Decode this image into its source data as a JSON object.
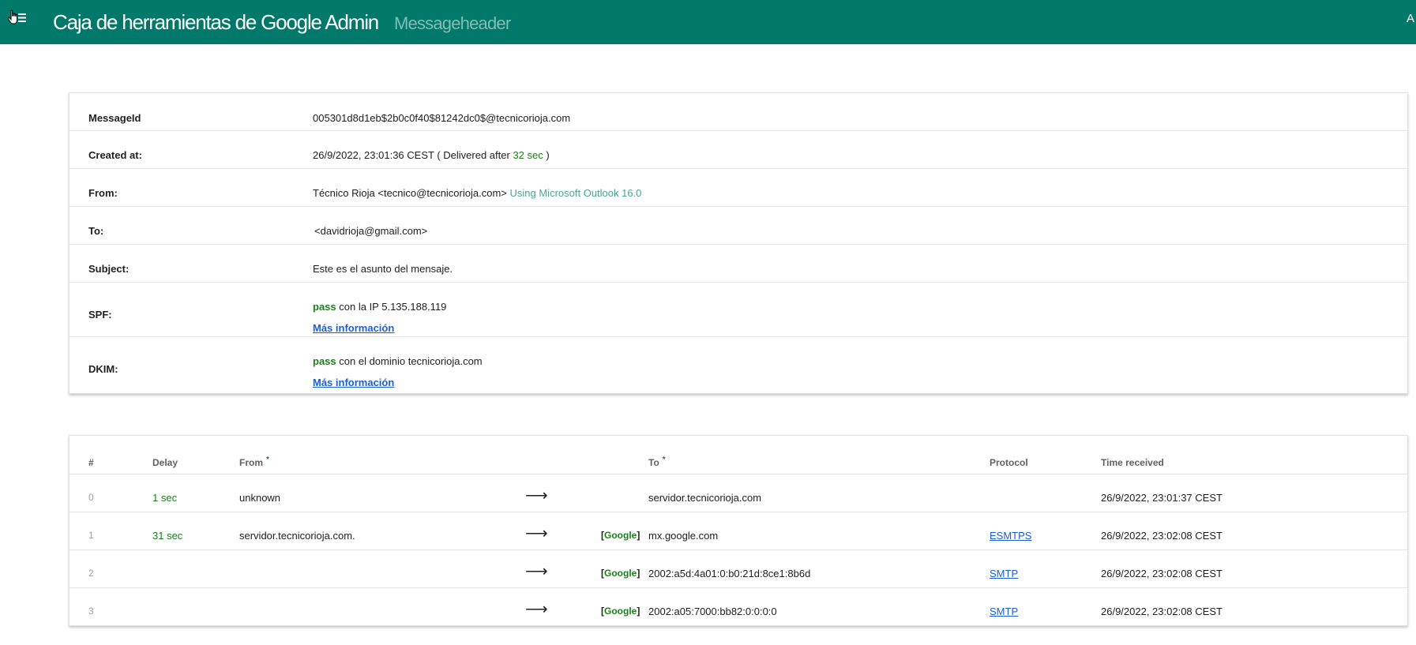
{
  "header": {
    "title": "Caja de herramientas de Google Admin",
    "subtitle": "Messageheader",
    "right_text": "A"
  },
  "details": {
    "message_id": {
      "label": "MessageId",
      "value": "005301d8d1eb$2b0c0f40$81242dc0$@tecnicorioja.com"
    },
    "created_at": {
      "label": "Created at:",
      "value": "26/9/2022, 23:01:36 CEST",
      "delivered_prefix": "( Delivered after",
      "delivered_time": "32 sec",
      "delivered_suffix": ")"
    },
    "from": {
      "label": "From:",
      "value": "Técnico Rioja <tecnico@tecnicorioja.com>",
      "client": "Using Microsoft Outlook 16.0"
    },
    "to": {
      "label": "To:",
      "value": "<davidrioja@gmail.com>"
    },
    "subject": {
      "label": "Subject:",
      "value": "Este es el asunto del mensaje."
    },
    "spf": {
      "label": "SPF:",
      "result": "pass",
      "detail": "con la IP 5.135.188.119",
      "link": "Más información"
    },
    "dkim": {
      "label": "DKIM:",
      "result": "pass",
      "detail": "con el dominio tecnicorioja.com",
      "link": "Más información"
    }
  },
  "hops": {
    "columns": {
      "num": "#",
      "delay": "Delay",
      "from": "From",
      "to": "To",
      "protocol": "Protocol",
      "time": "Time received",
      "star": "*"
    },
    "arrow": "⟶",
    "google_open": "[",
    "google_label": "Google",
    "google_close": "]",
    "rows": [
      {
        "num": "0",
        "delay": "1 sec",
        "from": "unknown",
        "google": false,
        "to": "servidor.tecnicorioja.com",
        "protocol": "",
        "time": "26/9/2022, 23:01:37 CEST"
      },
      {
        "num": "1",
        "delay": "31 sec",
        "from": "servidor.tecnicorioja.com.",
        "google": true,
        "to": "mx.google.com",
        "protocol": "ESMTPS",
        "time": "26/9/2022, 23:02:08 CEST"
      },
      {
        "num": "2",
        "delay": "",
        "from": "",
        "google": true,
        "to": "2002:a5d:4a01:0:b0:21d:8ce1:8b6d",
        "protocol": "SMTP",
        "time": "26/9/2022, 23:02:08 CEST"
      },
      {
        "num": "3",
        "delay": "",
        "from": "",
        "google": true,
        "to": "2002:a05:7000:bb82:0:0:0:0",
        "protocol": "SMTP",
        "time": "26/9/2022, 23:02:08 CEST"
      }
    ]
  },
  "colors": {
    "topbar": "#01796a",
    "green": "#1b7e1f",
    "teal": "#4aa395",
    "link": "#1a5fd6"
  }
}
